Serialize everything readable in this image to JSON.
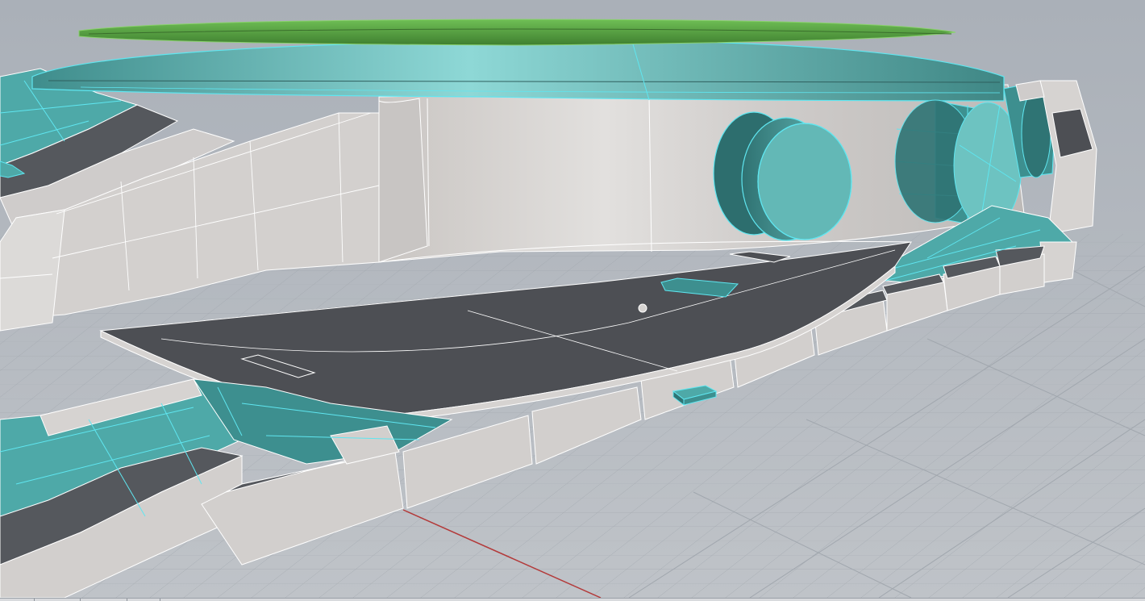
{
  "viewport": {
    "view_mode": "shaded",
    "grid": true,
    "selection_highlight_color": "#5fe6f0",
    "object_colors": {
      "case_body": "#d2d0ce",
      "bezel_top": "#4f9a3c",
      "selected_surface": "#4ea9a8",
      "dark_panel": "#4d4f54",
      "background": "#b4b9c0",
      "x_axis": "#b33a3a"
    },
    "objects": [
      "case-body",
      "bezel-ring",
      "crown",
      "pusher",
      "lug",
      "bracelet-left",
      "bracelet-right",
      "caseback-plate",
      "clasp-part"
    ]
  }
}
